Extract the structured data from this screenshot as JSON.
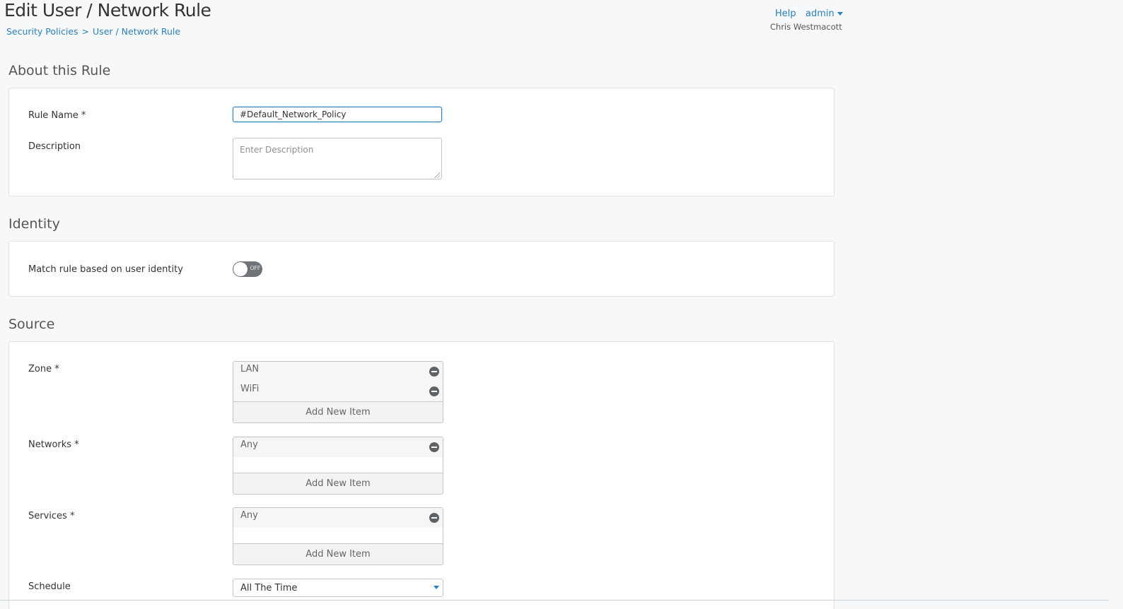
{
  "header": {
    "title": "Edit User / Network Rule",
    "breadcrumb": {
      "parent": "Security Policies",
      "separator": ">",
      "current": "User / Network Rule"
    },
    "help": "Help",
    "admin": "admin",
    "user_name": "Chris Westmacott"
  },
  "about": {
    "title": "About this Rule",
    "rule_name_label": "Rule Name *",
    "rule_name_value": "#Default_Network_Policy",
    "description_label": "Description",
    "description_placeholder": "Enter Description"
  },
  "identity": {
    "title": "Identity",
    "match_label": "Match rule based on user identity",
    "toggle_state": "OFF"
  },
  "source": {
    "title": "Source",
    "zone_label": "Zone *",
    "zones": [
      "LAN",
      "WiFi"
    ],
    "networks_label": "Networks *",
    "networks": [
      "Any"
    ],
    "services_label": "Services *",
    "services": [
      "Any"
    ],
    "add_new_item": "Add New Item",
    "schedule_label": "Schedule",
    "schedule_value": "All The Time"
  },
  "colors": {
    "accent": "#2a80b9",
    "background": "#f7f8f9",
    "panel_border": "#dfe3e6",
    "toggle_off": "#707478"
  }
}
